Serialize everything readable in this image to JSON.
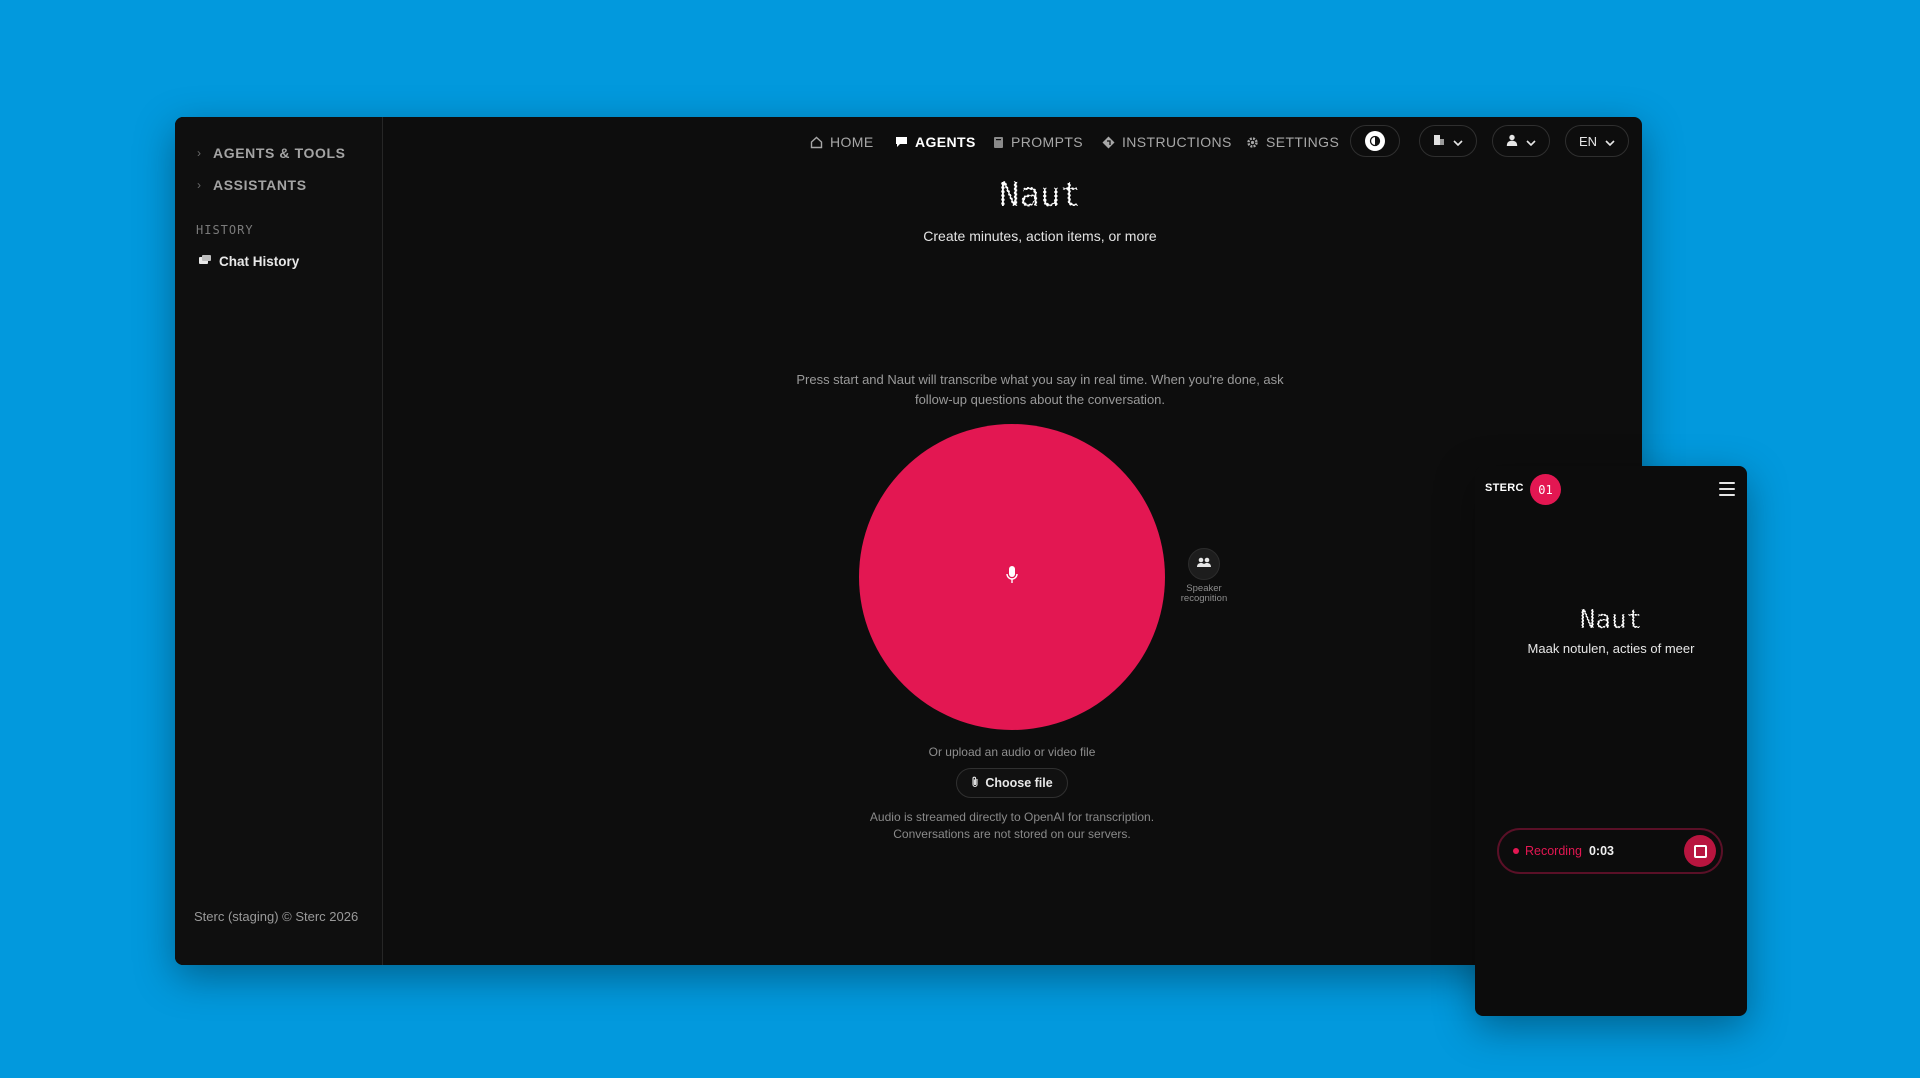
{
  "sidebar": {
    "items": [
      {
        "label": "AGENTS & TOOLS"
      },
      {
        "label": "ASSISTANTS"
      }
    ],
    "history_label": "HISTORY",
    "chat_history": "Chat History",
    "footer": "Sterc (staging) © Sterc 2026"
  },
  "nav": {
    "home": "HOME",
    "agents": "AGENTS",
    "prompts": "PROMPTS",
    "instructions": "INSTRUCTIONS",
    "settings": "SETTINGS",
    "language": "EN"
  },
  "main": {
    "title": "Naut",
    "subtitle": "Create minutes, action items, or more",
    "description": "Press start and Naut will transcribe what you say in real time. When you're done, ask follow-up questions about the conversation.",
    "speaker_label": "Speaker recognition",
    "upload_text": "Or upload an audio or video file",
    "choose_file": "Choose file",
    "disclaimer_line1": "Audio is streamed directly to OpenAI for transcription.",
    "disclaimer_line2": "Conversations are not stored on our servers."
  },
  "mobile": {
    "brand": "STERC",
    "badge": "01",
    "title": "Naut",
    "subtitle": "Maak notulen, acties of meer",
    "recording_label": "Recording",
    "recording_time": "0:03"
  },
  "colors": {
    "background": "#0299DD",
    "accent": "#E31752",
    "panel": "#0D0D0D"
  },
  "icons": [
    "chevron-right-icon",
    "chat-icon",
    "home-icon",
    "agents-icon",
    "prompts-icon",
    "instructions-icon",
    "settings-icon",
    "theme-icon",
    "building-icon",
    "user-icon",
    "chevron-down-icon",
    "microphone-icon",
    "speaker-recognition-icon",
    "paperclip-icon",
    "menu-icon",
    "stop-icon"
  ]
}
